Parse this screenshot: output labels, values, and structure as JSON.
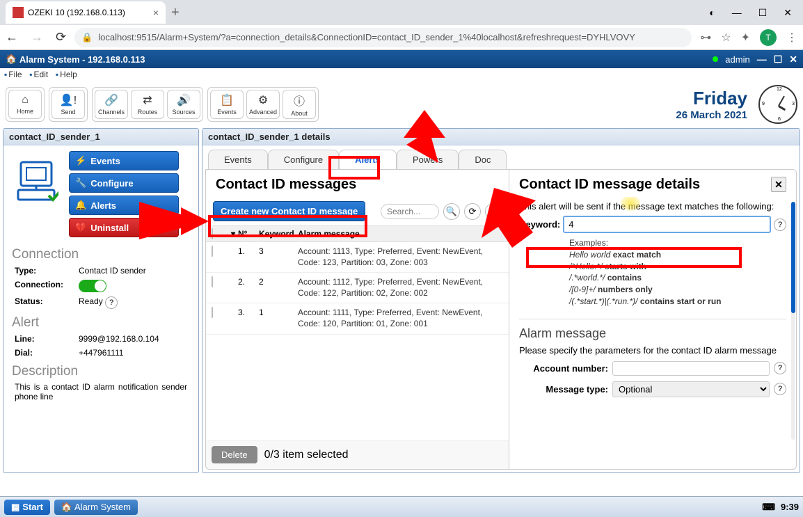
{
  "browser": {
    "tab_title": "OZEKI 10 (192.168.0.113)",
    "url": "localhost:9515/Alarm+System/?a=connection_details&ConnectionID=contact_ID_sender_1%40localhost&refreshrequest=DYHLVOVY",
    "avatar_letter": "T"
  },
  "app": {
    "title": "Alarm System - 192.168.0.113",
    "user": "admin"
  },
  "menubar": [
    "File",
    "Edit",
    "Help"
  ],
  "toolbar": [
    {
      "label": "Home",
      "icon": "⌂"
    },
    {
      "label": "Send",
      "icon": "👤!"
    },
    {
      "label": "Channels",
      "icon": "🔗"
    },
    {
      "label": "Routes",
      "icon": "⇄"
    },
    {
      "label": "Sources",
      "icon": "🔊"
    },
    {
      "label": "Events",
      "icon": "📋"
    },
    {
      "label": "Advanced",
      "icon": "⚙"
    },
    {
      "label": "About",
      "icon": "ⓘ"
    }
  ],
  "date": {
    "day": "Friday",
    "full": "26 March 2021"
  },
  "sidebar": {
    "title": "contact_ID_sender_1",
    "buttons": {
      "events": "Events",
      "configure": "Configure",
      "alerts": "Alerts",
      "uninstall": "Uninstall"
    },
    "connection_hdr": "Connection",
    "type_k": "Type:",
    "type_v": "Contact ID sender",
    "conn_k": "Connection:",
    "status_k": "Status:",
    "status_v": "Ready",
    "alert_hdr": "Alert",
    "line_k": "Line:",
    "line_v": "9999@192.168.0.104",
    "dial_k": "Dial:",
    "dial_v": "+447961111",
    "desc_hdr": "Description",
    "desc_txt": "This is a contact ID alarm notification sender phone line"
  },
  "detail": {
    "title": "contact_ID_sender_1 details",
    "tabs": [
      "Events",
      "Configure",
      "Alerts",
      "Powers",
      "Doc"
    ],
    "active_tab": "Alerts"
  },
  "messages": {
    "header": "Contact ID messages",
    "create_btn": "Create new Contact ID message",
    "search_ph": "Search...",
    "cols": {
      "num": "N°",
      "kw": "Keyword",
      "msg": "Alarm message"
    },
    "rows": [
      {
        "n": "1.",
        "kw": "3",
        "msg": "Account: 1113, Type: Preferred, Event: NewEvent, Code: 123, Partition: 03, Zone: 003"
      },
      {
        "n": "2.",
        "kw": "2",
        "msg": "Account: 1112, Type: Preferred, Event: NewEvent, Code: 122, Partition: 02, Zone: 002"
      },
      {
        "n": "3.",
        "kw": "1",
        "msg": "Account: 1111, Type: Preferred, Event: NewEvent, Code: 120, Partition: 01, Zone: 001"
      }
    ],
    "delete": "Delete",
    "sel_text": "0/3 item selected"
  },
  "right": {
    "header": "Contact ID message details",
    "intro": "This alert will be sent if the message text matches the following:",
    "kw_label": "Keyword:",
    "kw_value": "4",
    "examples_hdr": "Examples:",
    "ex1_i": "Hello world",
    "ex1_b": "exact match",
    "ex2_i": "/^Hello.*/",
    "ex2_b": "starts with",
    "ex3_i": "/.*world.*/",
    "ex3_b": "contains",
    "ex4_i": "/[0-9]+/",
    "ex4_b": "numbers only",
    "ex5_i": "/(.*start.*)|(.*run.*)/",
    "ex5_b": "contains start or run",
    "alarm_hdr": "Alarm message",
    "alarm_txt": "Please specify the parameters for the contact ID alarm message",
    "acct_label": "Account number:",
    "msgtype_label": "Message type:",
    "msgtype_val": "Optional"
  },
  "taskbar": {
    "start": "Start",
    "app": "Alarm System",
    "time": "9:39"
  }
}
